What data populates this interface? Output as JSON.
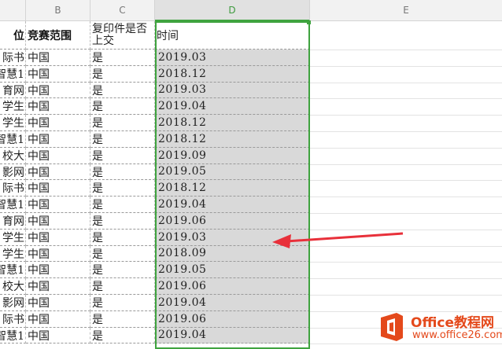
{
  "columns": [
    "B",
    "C",
    "D",
    "E"
  ],
  "header_row": {
    "a_partial": "位",
    "b": "竞赛范围",
    "c": "复印件是否上交",
    "d": "时间"
  },
  "rows": [
    {
      "a": "际书",
      "b": "中国",
      "c": "是",
      "d": "2019.03"
    },
    {
      "a": "智慧1",
      "b": "中国",
      "c": "是",
      "d": "2018.12"
    },
    {
      "a": "育网",
      "b": "中国",
      "c": "是",
      "d": "2019.03"
    },
    {
      "a": "学生",
      "b": "中国",
      "c": "是",
      "d": "2019.04"
    },
    {
      "a": "学生",
      "b": "中国",
      "c": "是",
      "d": "2018.12"
    },
    {
      "a": "智慧1",
      "b": "中国",
      "c": "是",
      "d": "2018.12"
    },
    {
      "a": "校大",
      "b": "中国",
      "c": "是",
      "d": "2019.09"
    },
    {
      "a": "影网",
      "b": "中国",
      "c": "是",
      "d": "2019.05"
    },
    {
      "a": "际书",
      "b": "中国",
      "c": "是",
      "d": "2018.12"
    },
    {
      "a": "智慧1",
      "b": "中国",
      "c": "是",
      "d": "2019.04"
    },
    {
      "a": "育网",
      "b": "中国",
      "c": "是",
      "d": "2019.06"
    },
    {
      "a": "学生",
      "b": "中国",
      "c": "是",
      "d": "2019.03"
    },
    {
      "a": "学生",
      "b": "中国",
      "c": "是",
      "d": "2018.09"
    },
    {
      "a": "智慧1",
      "b": "中国",
      "c": "是",
      "d": "2019.05"
    },
    {
      "a": "校大",
      "b": "中国",
      "c": "是",
      "d": "2019.06"
    },
    {
      "a": "影网",
      "b": "中国",
      "c": "是",
      "d": "2019.04"
    },
    {
      "a": "际书",
      "b": "中国",
      "c": "是",
      "d": "2019.06"
    },
    {
      "a": "智慧1",
      "b": "中国",
      "c": "是",
      "d": "2019.04"
    }
  ],
  "logo": {
    "brand": "Office教程网",
    "url": "www.office26.com"
  },
  "colors": {
    "selection": "#3fa33f",
    "selected_fill": "#d9d9d9",
    "arrow": "#e8303a",
    "logo": "#e4491b"
  }
}
